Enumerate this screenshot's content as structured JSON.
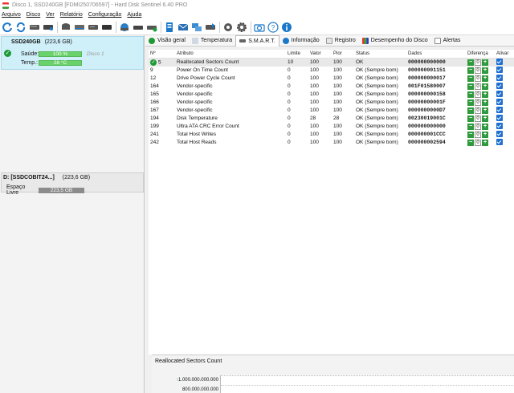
{
  "window": {
    "title": "Disco 1, SSD240GB [FDMI250706597] - Hard Disk Sentinel 6.40 PRO"
  },
  "menu": [
    "Arquivo",
    "Disco",
    "Ver",
    "Relatório",
    "Configuração",
    "Ajuda"
  ],
  "toolbar_icons": [
    "refresh-icon",
    "sync-icon",
    "disk-drive-icon",
    "disk-info-icon",
    "disk-read-icon",
    "disk-write-icon",
    "disk-test-icon",
    "disk-surface-icon",
    "drive-icon",
    "drive-monitor-icon",
    "drive-check-icon",
    "report-icon",
    "mail-icon",
    "network-icon",
    "send-icon",
    "settings-icon",
    "gear-icon",
    "camera-icon",
    "help-icon",
    "info-icon"
  ],
  "left": {
    "disk": {
      "name": "SSD240GB",
      "size": "(223,6 GB)",
      "health_label": "Saúde:",
      "health_value": "100 %",
      "health_fraction": 1.0,
      "disk_label": "Disco 1",
      "temp_label": "Temp.:",
      "temp_value": "28 °C"
    },
    "volume": {
      "name": "D: [SSDCOBIT24...]",
      "size": "(223,6 GB)",
      "free_label": "Espaço Livre",
      "free_value": "223,5 GB"
    }
  },
  "tabs": [
    {
      "label": "Visão geral",
      "icon": "check-icon"
    },
    {
      "label": "Temperatura",
      "icon": "thermometer-icon"
    },
    {
      "label": "S.M.A.R.T.",
      "icon": "smart-icon"
    },
    {
      "label": "Informação",
      "icon": "info-icon"
    },
    {
      "label": "Registro",
      "icon": "log-icon"
    },
    {
      "label": "Desempenho do Disco",
      "icon": "performance-icon"
    },
    {
      "label": "Alertas",
      "icon": "alert-icon"
    }
  ],
  "smart": {
    "columns": [
      "Nº",
      "Atributo",
      "Limite",
      "Valor",
      "Pior",
      "Status",
      "Dados",
      "Diferença",
      "Ativar"
    ],
    "rows": [
      {
        "id": "5",
        "attr": "Reallocated Sectors Count",
        "limit": "10",
        "value": "100",
        "worst": "100",
        "status": "OK",
        "data": "000000000000",
        "diff": "0"
      },
      {
        "id": "9",
        "attr": "Power On Time Count",
        "limit": "0",
        "value": "100",
        "worst": "100",
        "status": "OK (Sempre bom)",
        "data": "000000001151",
        "diff": "0"
      },
      {
        "id": "12",
        "attr": "Drive Power Cycle Count",
        "limit": "0",
        "value": "100",
        "worst": "100",
        "status": "OK (Sempre bom)",
        "data": "000000000017",
        "diff": "0"
      },
      {
        "id": "164",
        "attr": "Vendor-specific",
        "limit": "0",
        "value": "100",
        "worst": "100",
        "status": "OK (Sempre bom)",
        "data": "001F01580007",
        "diff": "0"
      },
      {
        "id": "165",
        "attr": "Vendor-specific",
        "limit": "0",
        "value": "100",
        "worst": "100",
        "status": "OK (Sempre bom)",
        "data": "000000000158",
        "diff": "0"
      },
      {
        "id": "166",
        "attr": "Vendor-specific",
        "limit": "0",
        "value": "100",
        "worst": "100",
        "status": "OK (Sempre bom)",
        "data": "00000000001F",
        "diff": "0"
      },
      {
        "id": "167",
        "attr": "Vendor-specific",
        "limit": "0",
        "value": "100",
        "worst": "100",
        "status": "OK (Sempre bom)",
        "data": "0000000000D7",
        "diff": "0"
      },
      {
        "id": "194",
        "attr": "Disk Temperature",
        "limit": "0",
        "value": "28",
        "worst": "28",
        "status": "OK (Sempre bom)",
        "data": "00230019001C",
        "diff": "0"
      },
      {
        "id": "199",
        "attr": "Ultra ATA CRC Error Count",
        "limit": "0",
        "value": "100",
        "worst": "100",
        "status": "OK (Sempre bom)",
        "data": "000000000000",
        "diff": "0"
      },
      {
        "id": "241",
        "attr": "Total Host Writes",
        "limit": "0",
        "value": "100",
        "worst": "100",
        "status": "OK (Sempre bom)",
        "data": "000000001CCC",
        "diff": "0"
      },
      {
        "id": "242",
        "attr": "Total Host Reads",
        "limit": "0",
        "value": "100",
        "worst": "100",
        "status": "OK (Sempre bom)",
        "data": "000000002594",
        "diff": "0"
      }
    ]
  },
  "chart": {
    "title": "Reallocated Sectors Count",
    "y_labels": [
      "1.000.000.000.000",
      "800.000.000.000"
    ]
  },
  "colors": {
    "ok_green": "#1e9a37",
    "selection_blue": "#cfeff9",
    "accent_blue": "#1d6fd1"
  }
}
